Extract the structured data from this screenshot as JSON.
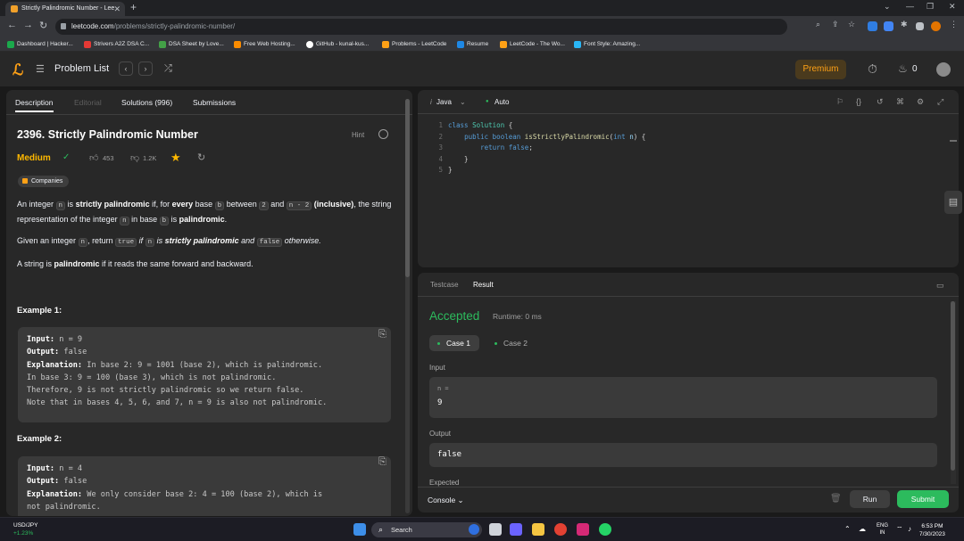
{
  "browser": {
    "tab_title": "Strictly Palindromic Number - Lee",
    "url_host": "leetcode.com",
    "url_path": "/problems/strictly-palindromic-number/"
  },
  "bookmarks": [
    {
      "label": "Dashboard | Hacker...",
      "color": "#1ba94c"
    },
    {
      "label": "Strivers A2Z DSA C...",
      "color": "#e53935"
    },
    {
      "label": "DSA Sheet by Love...",
      "color": "#43a047"
    },
    {
      "label": "Free Web Hosting...",
      "color": "#fb8c00"
    },
    {
      "label": "GitHub - kunal-kus...",
      "color": "#ffffff"
    },
    {
      "label": "Problems - LeetCode",
      "color": "#ffa116"
    },
    {
      "label": "Resume",
      "color": "#1e88e5"
    },
    {
      "label": "LeetCode - The Wo...",
      "color": "#ffa116"
    },
    {
      "label": "Font Style: Amazing...",
      "color": "#29b6f6"
    }
  ],
  "lc_nav": {
    "problem_list": "Problem List",
    "premium": "Premium",
    "streak": "0"
  },
  "left_tabs": [
    "Description",
    "Editorial",
    "Solutions (996)",
    "Submissions"
  ],
  "problem": {
    "title": "2396. Strictly Palindromic Number",
    "hint": "Hint",
    "difficulty": "Medium",
    "likes": "453",
    "dislikes": "1.2K",
    "companies": "Companies",
    "p1": {
      "a": "An integer ",
      "n": "n",
      "b": " is ",
      "strict": "strictly palindromic",
      "c": " if, for ",
      "every": "every",
      "d": " base ",
      "b_code": "b",
      "e": " between ",
      "two": "2",
      "f": " and ",
      "nm2": "n - 2",
      "g": " ",
      "incl": "(inclusive)",
      "h": ", the string representation of the integer ",
      "n2": "n",
      "i": " in base ",
      "b2": "b",
      "j": " is ",
      "pal": "palindromic",
      "k": "."
    },
    "p2": {
      "a": "Given an integer ",
      "n": "n",
      "b": ", return ",
      "true": "true",
      "c": " if ",
      "n2": "n",
      "d": " is ",
      "strict": "strictly palindromic",
      "e": " and ",
      "false": "false",
      "f": " otherwise."
    },
    "p3": {
      "a": "A string is ",
      "pal": "palindromic",
      "b": " if it reads the same forward and backward."
    },
    "ex1_title": "Example 1:",
    "ex1": {
      "input_label": "Input:",
      "input": " n = 9",
      "output_label": "Output:",
      "output": " false",
      "expl_label": "Explanation:",
      "expl": [
        " In base 2: 9 = 1001 (base 2), which is palindromic.",
        "In base 3: 9 = 100 (base 3), which is not palindromic.",
        "Therefore, 9 is not strictly palindromic so we return false.",
        "Note that in bases 4, 5, 6, and 7, n = 9 is also not palindromic."
      ]
    },
    "ex2_title": "Example 2:",
    "ex2": {
      "input_label": "Input:",
      "input": " n = 4",
      "output_label": "Output:",
      "output": " false",
      "expl_label": "Explanation:",
      "expl": [
        " We only consider base 2: 4 = 100 (base 2), which is",
        "not palindromic."
      ]
    }
  },
  "editor": {
    "language": "Java",
    "mode": "Auto",
    "line_numbers": [
      "1",
      "2",
      "3",
      "4",
      "5"
    ]
  },
  "result": {
    "tabs": [
      "Testcase",
      "Result"
    ],
    "status": "Accepted",
    "runtime": "Runtime: 0 ms",
    "cases": [
      "Case 1",
      "Case 2"
    ],
    "input_label": "Input",
    "input_var": "n =",
    "input_value": "9",
    "output_label": "Output",
    "output_value": "false",
    "expected_label": "Expected"
  },
  "console_bar": {
    "console": "Console",
    "run": "Run",
    "submit": "Submit"
  },
  "taskbar": {
    "ticker_name": "USD/JPY",
    "ticker_change": "+1.23%",
    "search": "Search",
    "lang": "ENG",
    "region": "IN",
    "time": "6:53 PM",
    "date": "7/30/2023"
  }
}
